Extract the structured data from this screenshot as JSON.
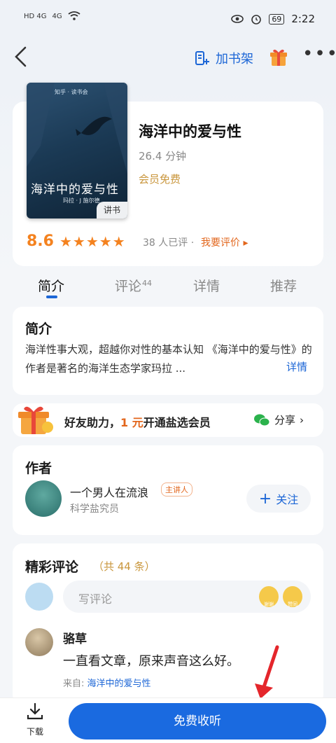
{
  "status_bar": {
    "time": "2:22",
    "battery": "69",
    "signal_left": "HD 4G",
    "signal_right": "4G"
  },
  "nav": {
    "add_shelf": "加书架"
  },
  "book": {
    "cover_brand": "知乎 · 读书会",
    "cover_title": "海洋中的爱与性",
    "cover_author": "玛拉 · J 施尔德",
    "cover_tag": "讲书",
    "title": "海洋中的爱与性",
    "duration": "26.4 分钟",
    "vip": "会员免费",
    "score": "8.6",
    "stars": 5,
    "rating_count": "38 人已评 ·",
    "rate_link": "我要评价 ▸"
  },
  "tabs": [
    {
      "label": "简介",
      "count": ""
    },
    {
      "label": "评论",
      "count": "44"
    },
    {
      "label": "详情",
      "count": ""
    },
    {
      "label": "推荐",
      "count": ""
    }
  ],
  "intro": {
    "title": "简介",
    "text": "海洋性事大观，超越你对性的基本认知 《海洋中的爱与性》的作者是著名的海洋生态学家玛拉 ...",
    "more": "详情"
  },
  "promo": {
    "prefix": "好友助力，",
    "highlight": "1 元",
    "suffix": "开通盐选会员",
    "share": "分享"
  },
  "author": {
    "title": "作者",
    "name": "一个男人在流浪",
    "badge": "主讲人",
    "role": "科学盐究员",
    "follow": "关注"
  },
  "comments": {
    "title": "精彩评论",
    "count": "（共 44 条）",
    "placeholder": "写评论",
    "emoji1": "谢谢",
    "emoji2": "赞同",
    "items": [
      {
        "name": "骆草",
        "text": "一直看文章，原来声音这么好。",
        "from_label": "来自: ",
        "from_book": "海洋中的爱与性"
      }
    ]
  },
  "bottom": {
    "download": "下载",
    "listen": "免费收听"
  },
  "colors": {
    "accent": "#1c66d6",
    "orange": "#f4821f",
    "gold": "#c9963c"
  }
}
